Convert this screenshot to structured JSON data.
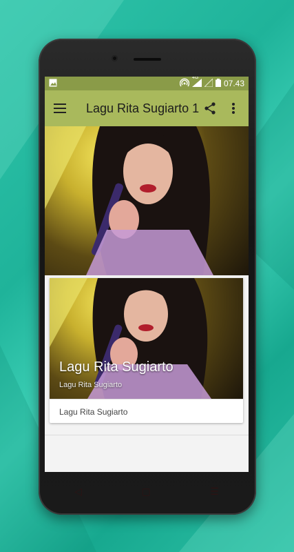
{
  "colors": {
    "background": "#2fc4aa",
    "statusbar": "#8a9b48",
    "appbar": "#a9b95c"
  },
  "statusbar": {
    "time": "07.43",
    "network": "4G",
    "icons": [
      "image-icon",
      "hotspot-icon",
      "signal-icon",
      "no-signal-icon",
      "battery-icon"
    ]
  },
  "appbar": {
    "title": "Lagu Rita Sugiarto 1",
    "icons": [
      "menu-icon",
      "share-icon",
      "more-vert-icon"
    ]
  },
  "card": {
    "title": "Lagu Rita Sugiarto",
    "subtitle": "Lagu Rita Sugiarto",
    "footer": "Lagu Rita Sugiarto"
  }
}
